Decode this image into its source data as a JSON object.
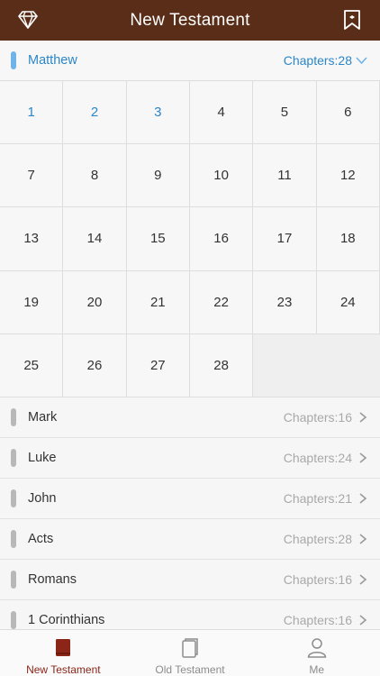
{
  "header": {
    "title": "New Testament",
    "left_icon": "diamond-icon",
    "right_icon": "bookmark-icon"
  },
  "current_book": {
    "name": "Matthew",
    "chapters_label": "Chapters:28",
    "chevron": "chevron-down-icon"
  },
  "chapters": [
    "1",
    "2",
    "3",
    "4",
    "5",
    "6",
    "7",
    "8",
    "9",
    "10",
    "11",
    "12",
    "13",
    "14",
    "15",
    "16",
    "17",
    "18",
    "19",
    "20",
    "21",
    "22",
    "23",
    "24",
    "25",
    "26",
    "27",
    "28"
  ],
  "read_chapters": [
    "1",
    "2",
    "3"
  ],
  "books": [
    {
      "name": "Mark",
      "chapters_label": "Chapters:16"
    },
    {
      "name": "Luke",
      "chapters_label": "Chapters:24"
    },
    {
      "name": "John",
      "chapters_label": "Chapters:21"
    },
    {
      "name": "Acts",
      "chapters_label": "Chapters:28"
    },
    {
      "name": "Romans",
      "chapters_label": "Chapters:16"
    },
    {
      "name": "1 Corinthians",
      "chapters_label": "Chapters:16"
    }
  ],
  "tabs": [
    {
      "label": "New Testament",
      "icon": "book-filled-icon",
      "active": true
    },
    {
      "label": "Old Testament",
      "icon": "book-outline-icon",
      "active": false
    },
    {
      "label": "Me",
      "icon": "person-icon",
      "active": false
    }
  ],
  "colors": {
    "header_bg": "#5a2d18",
    "accent_blue": "#2c86c6",
    "active_tab": "#8b2518"
  }
}
